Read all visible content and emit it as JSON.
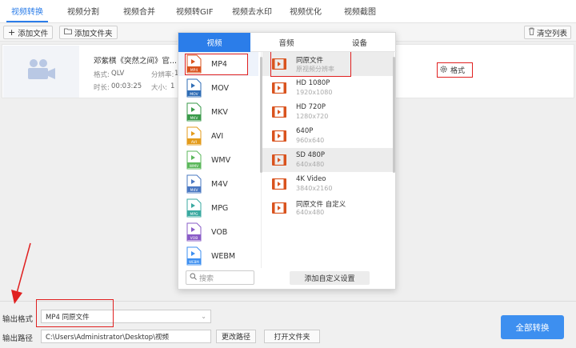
{
  "tabs": [
    "视频转换",
    "视频分割",
    "视频合并",
    "视频转GIF",
    "视频去水印",
    "视频优化",
    "视频截图"
  ],
  "toolbar": {
    "add_file": "添加文件",
    "add_folder": "添加文件夹",
    "clear_list": "清空列表"
  },
  "file": {
    "title": "邓紫棋《突然之间》官...",
    "format_label": "格式:",
    "format_value": "QLV",
    "resolution_label": "分辨率:",
    "resolution_value": "1",
    "duration_label": "时长:",
    "duration_value": "00:03:25",
    "size_label": "大小:",
    "size_value": "1",
    "settings_label": "格式"
  },
  "popup": {
    "tabs": [
      "视频",
      "音频",
      "设备"
    ],
    "formats": [
      "MP4",
      "MOV",
      "MKV",
      "AVI",
      "WMV",
      "M4V",
      "MPG",
      "VOB",
      "WEBM"
    ],
    "resolutions": [
      {
        "name": "同原文件",
        "sub": "原视频分辨率"
      },
      {
        "name": "HD 1080P",
        "sub": "1920x1080"
      },
      {
        "name": "HD 720P",
        "sub": "1280x720"
      },
      {
        "name": "640P",
        "sub": "960x640"
      },
      {
        "name": "SD 480P",
        "sub": "640x480"
      },
      {
        "name": "4K Video",
        "sub": "3840x2160"
      },
      {
        "name": "同原文件 自定义",
        "sub": "640x480"
      }
    ],
    "search_placeholder": "搜索",
    "add_custom": "添加自定义设置"
  },
  "bottom": {
    "output_format_label": "输出格式",
    "output_format_value": "MP4  同原文件",
    "output_path_label": "输出路径",
    "output_path_value": "C:\\Users\\Administrator\\Desktop\\视频",
    "change_path": "更改路径",
    "open_folder": "打开文件夹",
    "convert_all": "全部转换"
  },
  "colors": {
    "accent": "#2b7de9",
    "highlight_box": "#e02020",
    "mp4_icon": "#d9531e",
    "mov_icon": "#2f6db5",
    "mkv_icon": "#3a9a4a",
    "avi_icon": "#e39b1b",
    "wmv_icon": "#5cb85c",
    "m4v_icon": "#4a78c2",
    "mpg_icon": "#3aa9a0",
    "vob_icon": "#8a5cc7",
    "webm_icon": "#3d8ff0"
  }
}
